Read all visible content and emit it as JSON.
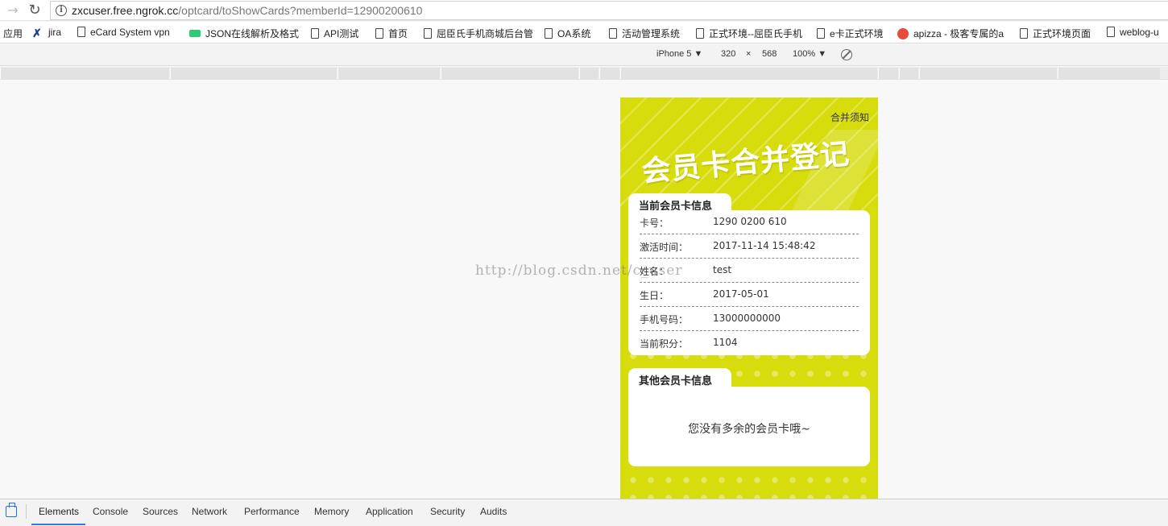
{
  "browser": {
    "url_host": "zxcuser.free.ngrok.cc",
    "url_path": "/optcard/toShowCards?memberId=12900200610",
    "bookmarks": [
      "应用",
      "jira",
      "eCard System vpn",
      "JSON在线解析及格式",
      "API测试",
      "首页",
      "屈臣氏手机商城后台管",
      "OA系统",
      "活动管理系统",
      "正式环境--屈臣氏手机",
      "e卡正式环境",
      "apizza - 极客专属的a",
      "正式环境页面",
      "weblog-u"
    ]
  },
  "device_toolbar": {
    "device": "iPhone 5 ▼",
    "width": "320",
    "times": "×",
    "height": "568",
    "zoom": "100% ▼"
  },
  "page": {
    "notice_link": "合并须知",
    "hero_title": "会员卡合并登记",
    "current_section_title": "当前会员卡信息",
    "current_card": [
      {
        "label": "卡号：",
        "value": "1290 0200 610"
      },
      {
        "label": "激活时间：",
        "value": "2017-11-14 15:48:42"
      },
      {
        "label": "姓名：",
        "value": "test"
      },
      {
        "label": "生日：",
        "value": "2017-05-01"
      },
      {
        "label": "手机号码：",
        "value": "13000000000"
      },
      {
        "label": "当前积分：",
        "value": "1104"
      }
    ],
    "other_section_title": "其他会员卡信息",
    "other_empty_message": "您没有多余的会员卡哦~",
    "accent_color": "#d7dc0c"
  },
  "watermark": "http://blog.csdn.net/c_user",
  "devtools": {
    "tabs": [
      "Elements",
      "Console",
      "Sources",
      "Network",
      "Performance",
      "Memory",
      "Application",
      "Security",
      "Audits"
    ],
    "active_tab": "Elements"
  }
}
